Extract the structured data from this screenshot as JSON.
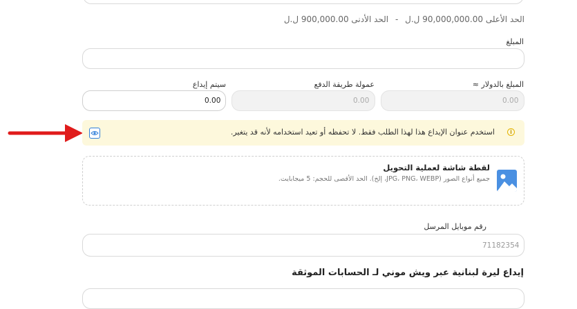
{
  "limits": {
    "max_text": "الحد الأعلى 90,000,000.00 ل.ل",
    "separator": "-",
    "min_text": "الحد الأدنى 900,000.00 ل.ل"
  },
  "amount": {
    "label": "المبلغ",
    "value": ""
  },
  "usd_amount": {
    "label": "المبلغ بالدولار ≈",
    "value": "0.00"
  },
  "fee": {
    "label": "عمولة طريقة الدفع",
    "value": "0.00"
  },
  "deposit": {
    "label": "سيتم إيداع",
    "value": "0.00"
  },
  "notice": {
    "text": "استخدم عنوان الإيداع هذا لهذا الطلب فقط. لا تحفظه أو تعيد استخدامه لأنه قد يتغير.",
    "bg_color": "#fdf8dc",
    "icon": "info-icon",
    "action_icon": "eye-icon"
  },
  "upload": {
    "title": "لقطة شاشة لعملية التحويل",
    "hint": "جميع أنواع الصور (JPG، PNG، WEBP، إلخ). الحد الأقصى للحجم: 5 ميجابايت.",
    "icon": "image-icon"
  },
  "mobile": {
    "label": "رقم موبايل المرسل",
    "placeholder": "71182354"
  },
  "section_title": "إيداع ليرة لبنانية عبر ويش موني لـ الحسابات الموثقة",
  "colors": {
    "arrow": "#e01b1b",
    "accent": "#2f7fd9",
    "warning": "#e4b400"
  }
}
